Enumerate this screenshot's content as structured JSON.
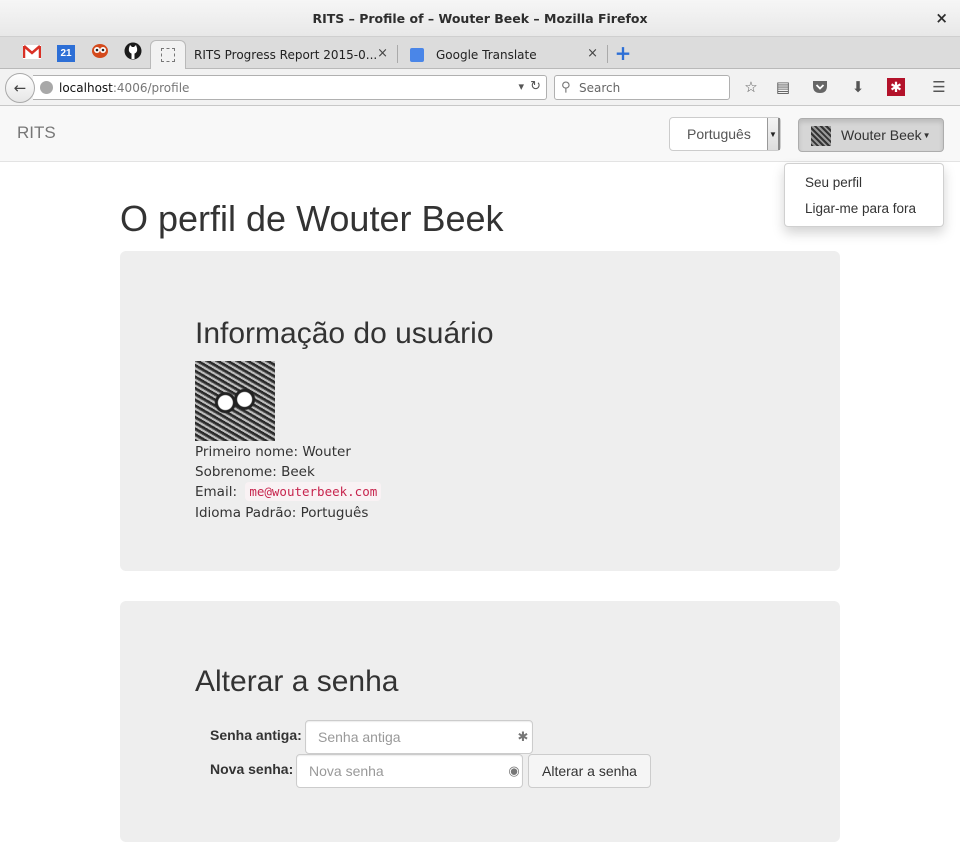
{
  "window": {
    "title": "RITS – Profile of – Wouter Beek – Mozilla Firefox",
    "close": "×"
  },
  "tabs": {
    "pinned": [
      "gmail-icon",
      "calendar-icon",
      "owl-icon",
      "github-icon",
      "blank-page-icon"
    ],
    "calendar_day": "21",
    "items": [
      {
        "label": "RITS Progress Report 2015-0...",
        "close": "×"
      },
      {
        "label": "Google Translate",
        "close": "×"
      }
    ],
    "new_tab": "+"
  },
  "navigation": {
    "url_host": "localhost",
    "url_path": ":4006/profile",
    "search_placeholder": "Search"
  },
  "app": {
    "brand": "RITS",
    "language": "Português",
    "user": "Wouter Beek",
    "menu": [
      "Seu perfil",
      "Ligar-me para fora"
    ]
  },
  "profile": {
    "page_title": "O perfil de Wouter Beek",
    "user_info_heading": "Informação do usuário",
    "first_name_label": "Primeiro nome:",
    "first_name": "Wouter",
    "last_name_label": "Sobrenome:",
    "last_name": "Beek",
    "email_label": "Email:",
    "email": "me@wouterbeek.com",
    "language_label": "Idioma Padrão:",
    "language": "Português"
  },
  "password": {
    "heading": "Alterar a senha",
    "old_label": "Senha antiga:",
    "old_placeholder": "Senha antiga",
    "new_label": "Nova senha:",
    "new_placeholder": "Nova senha",
    "submit": "Alterar a senha"
  }
}
